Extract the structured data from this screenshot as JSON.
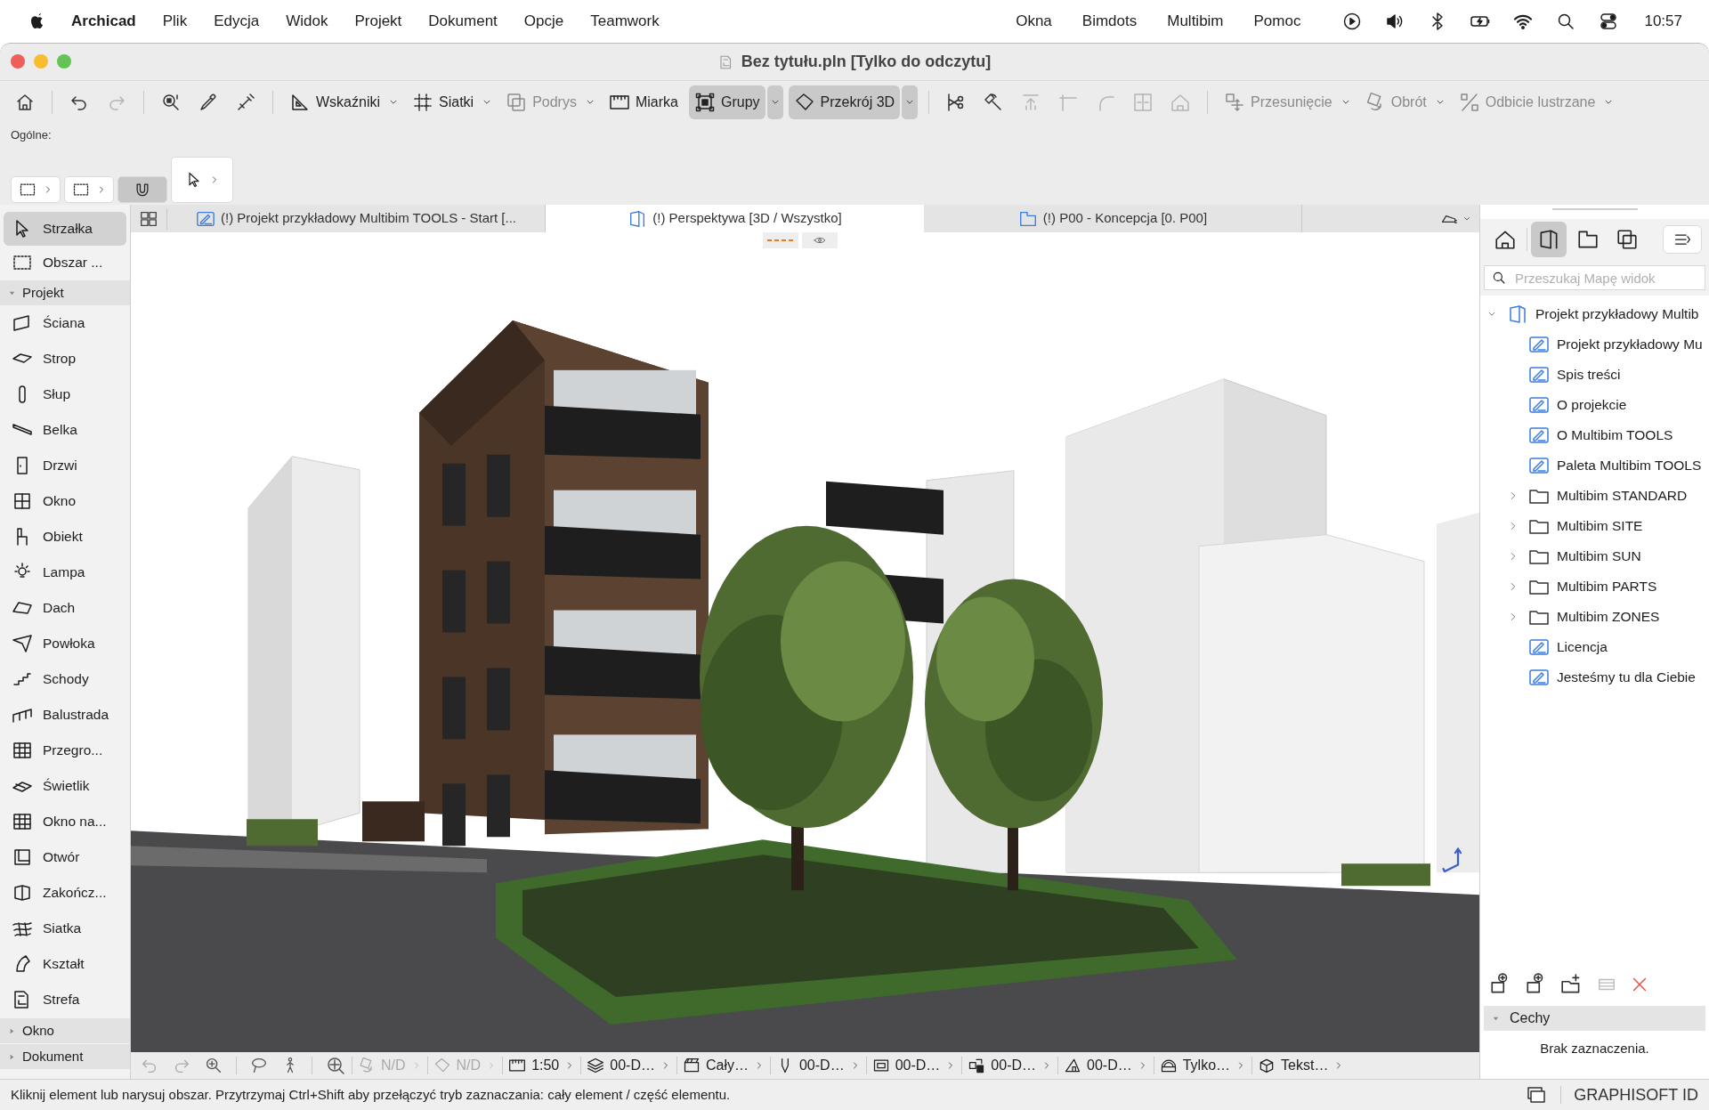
{
  "menubar": {
    "app": "Archicad",
    "items": [
      "Plik",
      "Edycja",
      "Widok",
      "Projekt",
      "Dokument",
      "Opcje",
      "Teamwork"
    ],
    "right_items": [
      "Okna",
      "Bimdots",
      "Multibim",
      "Pomoc"
    ],
    "clock": "10:57"
  },
  "window": {
    "title": "Bez tytułu.pln [Tylko do odczytu]"
  },
  "toolbar": {
    "items": [
      {
        "kind": "icon",
        "selected": false,
        "disabled": false
      },
      {
        "kind": "separator"
      },
      {
        "kind": "icon",
        "selected": false,
        "disabled": false
      },
      {
        "kind": "icon",
        "selected": false,
        "disabled": true
      },
      {
        "kind": "separator"
      },
      {
        "kind": "icon",
        "selected": false,
        "disabled": false
      },
      {
        "kind": "icon",
        "selected": false,
        "disabled": false
      },
      {
        "kind": "icon",
        "selected": false,
        "disabled": false
      },
      {
        "kind": "separator"
      },
      {
        "kind": "labeled",
        "label": "Wskaźniki",
        "selected": false,
        "disabled": false,
        "dropdown": true
      },
      {
        "kind": "labeled",
        "label": "Siatki",
        "selected": false,
        "disabled": false,
        "dropdown": true
      },
      {
        "kind": "labeled",
        "label": "Podrys",
        "selected": false,
        "disabled": true,
        "dropdown": true
      },
      {
        "kind": "labeled",
        "label": "Miarka",
        "selected": false,
        "disabled": false,
        "dropdown": false
      },
      {
        "kind": "labeled",
        "label": "Grupy",
        "selected": true,
        "disabled": false,
        "dropdown": true
      },
      {
        "kind": "labeled",
        "label": "Przekrój 3D",
        "selected": true,
        "disabled": false,
        "dropdown": true
      },
      {
        "kind": "separator"
      },
      {
        "kind": "icon",
        "selected": false,
        "disabled": false
      },
      {
        "kind": "icon",
        "selected": false,
        "disabled": false
      },
      {
        "kind": "icon",
        "selected": false,
        "disabled": true
      },
      {
        "kind": "icon",
        "selected": false,
        "disabled": true
      },
      {
        "kind": "icon",
        "selected": false,
        "disabled": true
      },
      {
        "kind": "icon",
        "selected": false,
        "disabled": true
      },
      {
        "kind": "icon",
        "selected": false,
        "disabled": true
      },
      {
        "kind": "separator"
      },
      {
        "kind": "labeled",
        "label": "Przesunięcie",
        "selected": false,
        "disabled": true,
        "dropdown": true
      },
      {
        "kind": "labeled",
        "label": "Obrót",
        "selected": false,
        "disabled": true,
        "dropdown": true
      },
      {
        "kind": "labeled",
        "label": "Odbicie lustrzane",
        "selected": false,
        "disabled": true,
        "dropdown": true
      }
    ]
  },
  "info_box": {
    "label": "Ogólne:",
    "tools": [
      {
        "selected": false
      },
      {
        "selected": false
      },
      {
        "selected": true
      },
      {
        "selected": false
      }
    ]
  },
  "tabs": [
    {
      "label": "(!) Projekt przykładowy Multibim TOOLS - Start [...",
      "selected": false
    },
    {
      "label": "(!) Perspektywa [3D / Wszystko]",
      "selected": true
    },
    {
      "label": "(!) P00 - Koncepcja [0. P00]",
      "selected": false
    }
  ],
  "toolbox": [
    {
      "kind": "tool",
      "label": "Strzałka",
      "selected": true
    },
    {
      "kind": "tool",
      "label": "Obszar ...",
      "selected": false
    },
    {
      "kind": "group",
      "label": "Projekt",
      "expanded": true,
      "children": [
        {
          "label": "Ściana",
          "selected": false
        },
        {
          "label": "Strop",
          "selected": false
        },
        {
          "label": "Słup",
          "selected": false
        },
        {
          "label": "Belka",
          "selected": false
        },
        {
          "label": "Drzwi",
          "selected": false
        },
        {
          "label": "Okno",
          "selected": false
        },
        {
          "label": "Obiekt",
          "selected": false
        },
        {
          "label": "Lampa",
          "selected": false
        },
        {
          "label": "Dach",
          "selected": false
        },
        {
          "label": "Powłoka",
          "selected": false
        },
        {
          "label": "Schody",
          "selected": false
        },
        {
          "label": "Balustrada",
          "selected": false
        },
        {
          "label": "Przegro...",
          "selected": false
        },
        {
          "label": "Świetlik",
          "selected": false
        },
        {
          "label": "Okno na...",
          "selected": false
        },
        {
          "label": "Otwór",
          "selected": false
        },
        {
          "label": "Zakończ...",
          "selected": false
        },
        {
          "label": "Siatka",
          "selected": false
        },
        {
          "label": "Kształt",
          "selected": false
        },
        {
          "label": "Strefa",
          "selected": false
        }
      ]
    },
    {
      "kind": "group",
      "label": "Okno",
      "expanded": false
    },
    {
      "kind": "group",
      "label": "Dokument",
      "expanded": false
    }
  ],
  "navigator": {
    "view_tabs": [
      {
        "selected": false
      },
      {
        "selected": true
      },
      {
        "selected": false
      },
      {
        "selected": false
      }
    ],
    "search": {
      "placeholder": "Przeszukaj Mapę widok"
    },
    "tree": [
      {
        "kind": "project",
        "label": "Projekt przykładowy Multib",
        "expanded": true,
        "children": [
          {
            "kind": "layout",
            "label": "Projekt przykładowy Mu"
          },
          {
            "kind": "layout",
            "label": "Spis treści"
          },
          {
            "kind": "layout",
            "label": "O projekcie"
          },
          {
            "kind": "layout",
            "label": "O Multibim TOOLS"
          },
          {
            "kind": "layout",
            "label": "Paleta Multibim TOOLS"
          },
          {
            "kind": "folder",
            "label": "Multibim STANDARD",
            "expanded": false
          },
          {
            "kind": "folder",
            "label": "Multibim SITE",
            "expanded": false
          },
          {
            "kind": "folder",
            "label": "Multibim SUN",
            "expanded": false
          },
          {
            "kind": "folder",
            "label": "Multibim PARTS",
            "expanded": false
          },
          {
            "kind": "folder",
            "label": "Multibim ZONES",
            "expanded": false
          },
          {
            "kind": "layout",
            "label": "Licencja"
          },
          {
            "kind": "layout",
            "label": "Jesteśmy tu dla Ciebie"
          }
        ]
      }
    ]
  },
  "properties": {
    "header": "Cechy",
    "expanded": true,
    "text": "Brak zaznaczenia."
  },
  "nav_bar": [
    {
      "label": "N/D",
      "disabled": true
    },
    {
      "label": "N/D",
      "disabled": true
    },
    {
      "label": "1:50",
      "disabled": false
    },
    {
      "label": "00-D…",
      "disabled": false
    },
    {
      "label": "Cały…",
      "disabled": false
    },
    {
      "label": "00-D…",
      "disabled": false
    },
    {
      "label": "00-D…",
      "disabled": false
    },
    {
      "label": "00-D…",
      "disabled": false
    },
    {
      "label": "00-D…",
      "disabled": false
    },
    {
      "label": "Tylko…",
      "disabled": false
    },
    {
      "label": "Tekst…",
      "disabled": false
    }
  ],
  "status_bar": {
    "text": "Kliknij element lub narysuj obszar. Przytrzymaj Ctrl+Shift aby przełączyć tryb zaznaczania: cały element / część elementu.",
    "brand": "GRAPHISOFT ID"
  }
}
